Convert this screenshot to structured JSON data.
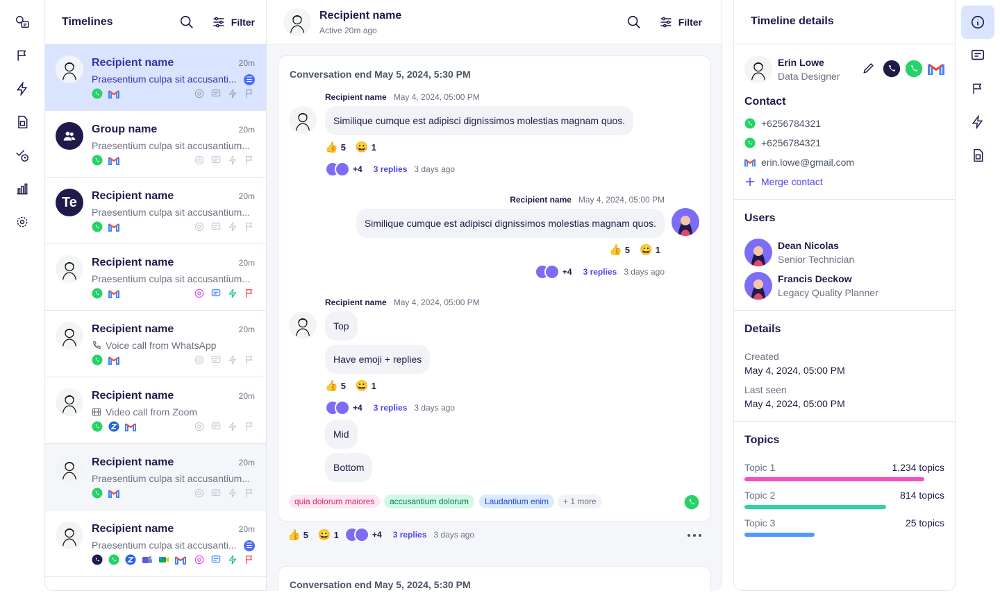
{
  "timelines": {
    "title": "Timelines",
    "filter_label": "Filter",
    "items": [
      {
        "name": "Recipient name",
        "time": "20m",
        "preview": "Praesentium culpa sit accusanti...",
        "badge": "☰"
      },
      {
        "name": "Group name",
        "time": "20m",
        "preview": "Praesentium culpa sit accusantium..."
      },
      {
        "name": "Recipient name",
        "time": "20m",
        "preview": "Praesentium culpa sit accusantium...",
        "initials": "Te"
      },
      {
        "name": "Recipient name",
        "time": "20m",
        "preview": "Praesentium culpa sit accusantium..."
      },
      {
        "name": "Recipient name",
        "time": "20m",
        "preview": "Voice call from WhatsApp"
      },
      {
        "name": "Recipient name",
        "time": "20m",
        "preview": "Video call from Zoom"
      },
      {
        "name": "Recipient name",
        "time": "20m",
        "preview": "Praesentium culpa sit accusantium..."
      },
      {
        "name": "Recipient name",
        "time": "20m",
        "preview": "Praesentium culpa sit accusanti...",
        "badge": "☰"
      }
    ]
  },
  "conversation": {
    "name": "Recipient name",
    "status": "Active 20m ago",
    "filter_label": "Filter",
    "card1": {
      "title": "Conversation end May 5, 2024, 5:30 PM",
      "messages": [
        {
          "sender": "Recipient name",
          "time": "May 4, 2024, 05:00 PM",
          "text": "Similique cumque est adipisci dignissimos molestias magnam quos.",
          "thumbs": "5",
          "smile": "1",
          "plus": "+4",
          "replies": "3 replies",
          "ago": "3 days ago"
        },
        {
          "sender": "Recipient name",
          "time": "May 4, 2024, 05:00 PM",
          "text": "Similique cumque est adipisci dignissimos molestias magnam quos.",
          "thumbs": "5",
          "smile": "1",
          "plus": "+4",
          "replies": "3 replies",
          "ago": "3 days ago"
        },
        {
          "sender": "Recipient name",
          "time": "May 4, 2024, 05:00 PM",
          "bubbles": [
            "Top",
            "Have emoji + replies",
            "Mid",
            "Bottom"
          ],
          "thumbs": "5",
          "smile": "1",
          "plus": "+4",
          "replies": "3 replies",
          "ago": "3 days ago"
        }
      ],
      "tags": [
        {
          "label": "quia dolorum maiores",
          "color": "#fce7f3",
          "text": "#db2777"
        },
        {
          "label": "accusantium dolorum",
          "color": "#d1fae5",
          "text": "#047857"
        },
        {
          "label": "Laudantium enim",
          "color": "#dbeafe",
          "text": "#1d4ed8"
        },
        {
          "label": "+ 1 more",
          "color": "#f1f3f7",
          "text": "#6b7280"
        }
      ]
    },
    "footer": {
      "thumbs": "5",
      "smile": "1",
      "plus": "+4",
      "replies": "3 replies",
      "ago": "3 days ago"
    },
    "card2": {
      "title": "Conversation end May 5, 2024, 5:30 PM"
    }
  },
  "details": {
    "title": "Timeline details",
    "person": {
      "name": "Erin Lowe",
      "role": "Data Designer"
    },
    "contact": {
      "title": "Contact",
      "phone1": "+6256784321",
      "phone2": "+6256784321",
      "email": "erin.lowe@gmail.com",
      "merge": "Merge contact"
    },
    "users": {
      "title": "Users",
      "list": [
        {
          "name": "Dean Nicolas",
          "role": "Senior Technician"
        },
        {
          "name": "Francis Deckow",
          "role": "Legacy Quality Planner"
        }
      ]
    },
    "info": {
      "title": "Details",
      "created_label": "Created",
      "created_value": "May 4, 2024, 05:00 PM",
      "seen_label": "Last seen",
      "seen_value": "May 4, 2024, 05:00 PM"
    },
    "topics": {
      "title": "Topics",
      "list": [
        {
          "name": "Topic 1",
          "count": "1,234 topics",
          "fraction": 0.9,
          "color": "#f44fbf"
        },
        {
          "name": "Topic 2",
          "count": "814 topics",
          "fraction": 0.71,
          "color": "#2dd4a7"
        },
        {
          "name": "Topic 3",
          "count": "25 topics",
          "fraction": 0.35,
          "color": "#4f9cf7"
        }
      ]
    }
  },
  "colors": {
    "accent": "#4f46e5",
    "active_bg": "#dbe4ff",
    "whatsapp": "#25d366",
    "navy": "#1e1b4b"
  }
}
